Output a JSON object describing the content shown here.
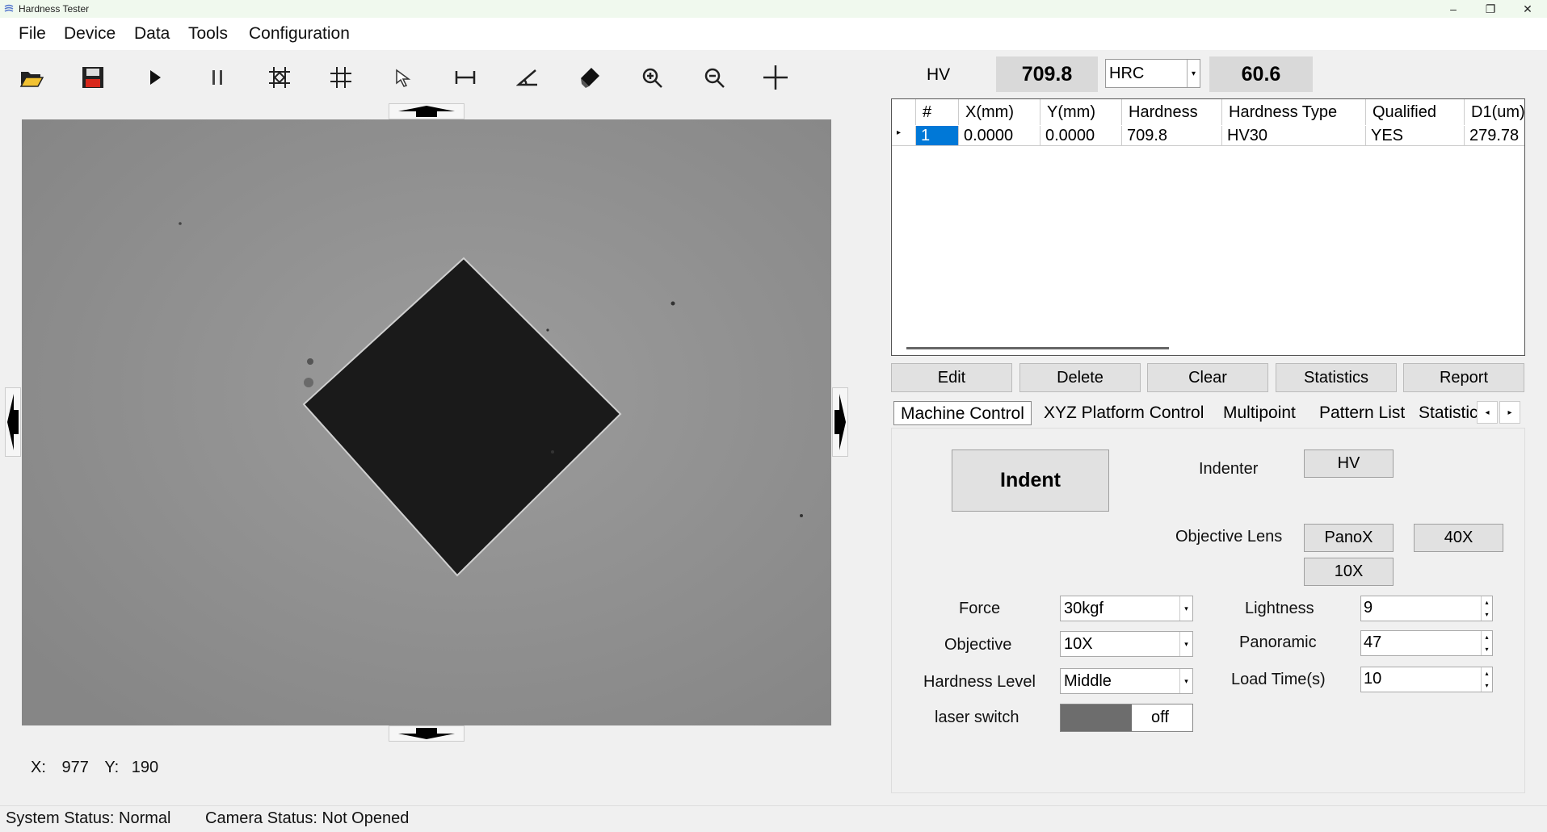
{
  "window": {
    "title": "Hardness Tester",
    "minimize_glyph": "–",
    "maximize_glyph": "❐",
    "close_glyph": "✕"
  },
  "menu": {
    "items": [
      "File",
      "Device",
      "Data",
      "Tools",
      "Configuration"
    ]
  },
  "toolbar": {
    "icons": [
      "open-folder-icon",
      "save-icon",
      "play-icon",
      "pause-icon",
      "auto-measure-icon",
      "grid-icon",
      "select-arrow-icon",
      "horizontal-measure-icon",
      "angle-icon",
      "eraser-icon",
      "zoom-in-icon",
      "zoom-out-icon",
      "crosshair-icon"
    ]
  },
  "readout": {
    "label": "HV",
    "hardness_value": "709.8",
    "conversion_scale": "HRC",
    "converted_value": "60.6"
  },
  "grid": {
    "columns": [
      "#",
      "X(mm)",
      "Y(mm)",
      "Hardness",
      "Hardness Type",
      "Qualified",
      "D1(um)"
    ],
    "rows": [
      {
        "num": "1",
        "x": "0.0000",
        "y": "0.0000",
        "hardness": "709.8",
        "type": "HV30",
        "qualified": "YES",
        "d1": "279.78"
      }
    ]
  },
  "actions": {
    "edit": "Edit",
    "delete": "Delete",
    "clear": "Clear",
    "statistics": "Statistics",
    "report": "Report"
  },
  "tabs": [
    "Machine Control",
    "XYZ Platform Control",
    "Multipoint",
    "Pattern List",
    "Statistic"
  ],
  "tab_nav": {
    "prev": "◂",
    "next": "▸"
  },
  "machine": {
    "indent_button": "Indent",
    "indenter_label": "Indenter",
    "indenter_value": "HV",
    "objective_lens_label": "Objective Lens",
    "lens_buttons": [
      "PanoX",
      "40X",
      "10X"
    ],
    "force_label": "Force",
    "force_value": "30kgf",
    "objective_label": "Objective",
    "objective_value": "10X",
    "hardness_level_label": "Hardness Level",
    "hardness_level_value": "Middle",
    "laser_label": "laser switch",
    "laser_state": "off",
    "lightness_label": "Lightness",
    "lightness_value": "9",
    "panoramic_label": "Panoramic",
    "panoramic_value": "47",
    "load_time_label": "Load Time(s)",
    "load_time_value": "10"
  },
  "coords": {
    "x_label": "X:",
    "x_value": "977",
    "y_label": "Y:",
    "y_value": "190"
  },
  "status": {
    "system": "System Status: Normal",
    "camera": "Camera Status: Not Opened"
  },
  "colors": {
    "titlebar_bg": "#f0f9ee",
    "image_bg": "#8b8b8b",
    "indent_fill": "#1a1a1a",
    "selection": "#0078d7",
    "readout_bg": "#d9d9d9"
  }
}
